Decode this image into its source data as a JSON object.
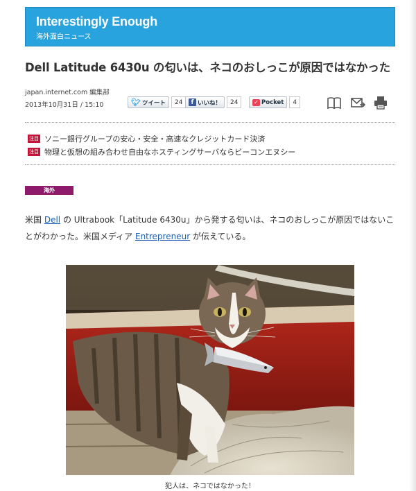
{
  "banner": {
    "title": "Interestingly Enough",
    "subtitle": "海外面白ニュース"
  },
  "article": {
    "headline": "Dell Latitude 6430u の匂いは、ネコのおしっこが原因ではなかった",
    "source": "japan.internet.com 編集部",
    "date": "2013年10月31日 / 15:10",
    "category": "海外",
    "body_1": "米国 ",
    "link_dell": "Dell",
    "body_2": " の Ultrabook「Latitude 6430u」から発する匂いは、ネコのおしっこが原因ではないことがわかった。米国メディア ",
    "link_entrepreneur": "Entrepreneur",
    "body_3": " が伝えている。",
    "caption": "犯人は、ネコではなかった！"
  },
  "share": {
    "tweet_label": "ツイート",
    "tweet_count": "24",
    "like_label": "いいね！",
    "like_count": "24",
    "pocket_label": "Pocket",
    "pocket_count": "4"
  },
  "tools": [
    "book-icon",
    "mail-icon",
    "print-icon"
  ],
  "ads": {
    "tag": "注目",
    "items": [
      "ソニー銀行グループの安心・安全・高速なクレジットカード決済",
      "物理と仮想の組み合わせ自由なホスティングサーバならビーコンエヌシー"
    ]
  },
  "colors": {
    "banner": "#29a3dd",
    "category": "#8e1a6b",
    "ad_tag": "#c4143a",
    "link": "#1a5fb4"
  }
}
